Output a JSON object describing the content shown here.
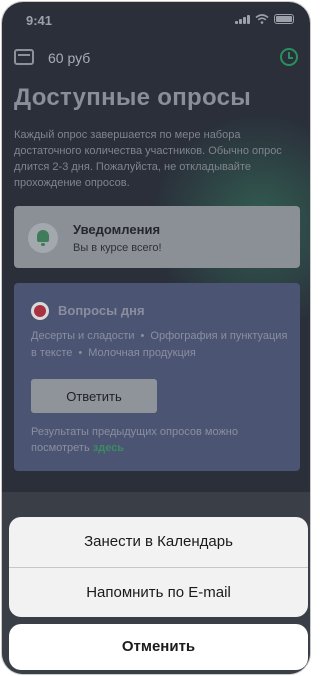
{
  "status_bar": {
    "time": "9:41"
  },
  "header": {
    "balance": "60 руб"
  },
  "page": {
    "title": "Доступные опросы",
    "intro": "Каждый опрос завершается по мере набора достаточного количества участников. Обычно опрос длится 2-3 дня. Пожалуйста, не откладывайте прохождение опросов."
  },
  "notifications": {
    "title": "Уведомления",
    "subtitle": "Вы в курсе всего!"
  },
  "questions": {
    "title": "Вопросы дня",
    "topics": [
      "Десерты и сладости",
      "Орфография и пунктуация в тексте",
      "Молочная продукция"
    ],
    "answer_label": "Ответить",
    "footer_text": "Результаты предыдущих опросов можно посмотреть",
    "footer_link": "здесь"
  },
  "action_sheet": {
    "options": [
      "Занести в Календарь",
      "Напомнить по E-mail"
    ],
    "cancel_label": "Отменить"
  },
  "colors": {
    "accent": "#2a8f5e",
    "overlay": "#2a2f3a"
  }
}
